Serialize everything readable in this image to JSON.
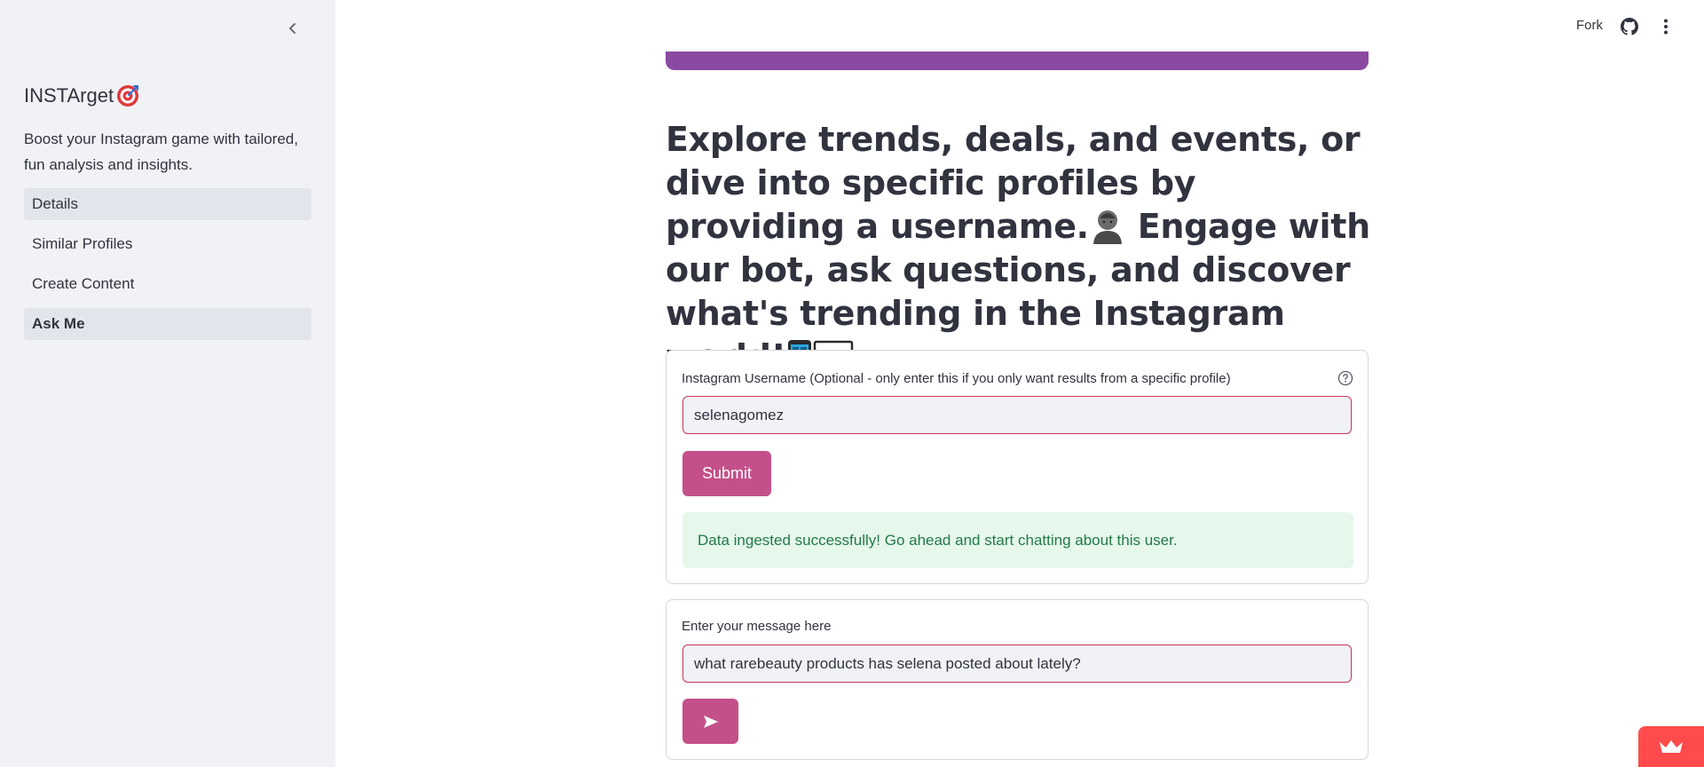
{
  "sidebar": {
    "title": "INSTArget",
    "title_emoji": "🎯",
    "description": "Boost your Instagram game with tailored, fun analysis and insights.",
    "nav_items": [
      {
        "label": "Details"
      },
      {
        "label": "Similar Profiles"
      },
      {
        "label": "Create Content"
      },
      {
        "label": "Ask Me"
      }
    ],
    "collapse_icon": "chevron-left-icon"
  },
  "header": {
    "fork_label": "Fork",
    "github_icon": "github-icon",
    "menu_icon": "vertical-dots-icon"
  },
  "main": {
    "headline_part1": "Explore trends, deals, and events, or dive into specific profiles by providing a username.",
    "headline_part2": "Engage with our bot, ask questions, and discover what's trending in the Instagram world!",
    "username_card": {
      "label": "Instagram Username (Optional - only enter this if you only want results from a specific profile)",
      "value": "selenagomez",
      "submit_label": "Submit",
      "success_message": "Data ingested successfully! Go ahead and start chatting about this user."
    },
    "message_card": {
      "label": "Enter your message here",
      "value": "what rarebeauty products has selena posted about lately?",
      "send_icon": "send-arrow-icon"
    }
  },
  "colors": {
    "sidebar_bg": "#f0f2f6",
    "banner": "#8a4aa1",
    "primary_button": "#c4508a",
    "input_border": "#c9345b",
    "success_bg": "#e6f7ec",
    "success_text": "#237a46",
    "badge": "#ff4b4b"
  }
}
